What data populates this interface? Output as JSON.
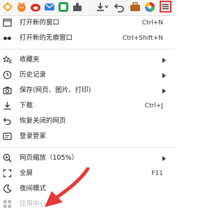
{
  "menu": {
    "new_window": {
      "label": "打开新的窗口",
      "shortcut": "Ctrl+N"
    },
    "new_incognito": {
      "label": "打开新的无痕窗口",
      "shortcut": "Ctrl+Shift+N"
    },
    "bookmarks": {
      "label": "收藏夹"
    },
    "history": {
      "label": "历史记录"
    },
    "save": {
      "label": "保存(网页、图片、打印)"
    },
    "downloads": {
      "label": "下载",
      "shortcut": "Ctrl+J"
    },
    "restore": {
      "label": "恢复关闭的网页"
    },
    "login_manager": {
      "label": "登录管家"
    },
    "zoom": {
      "label": "网页缩放（105%）"
    },
    "fullscreen": {
      "label": "全屏",
      "shortcut": "F11"
    },
    "night_mode": {
      "label": "夜间模式"
    },
    "partial": {
      "label": "应用中心"
    }
  },
  "colors": {
    "highlight_border": "#e53935",
    "annotation_arrow": "#e53935"
  }
}
